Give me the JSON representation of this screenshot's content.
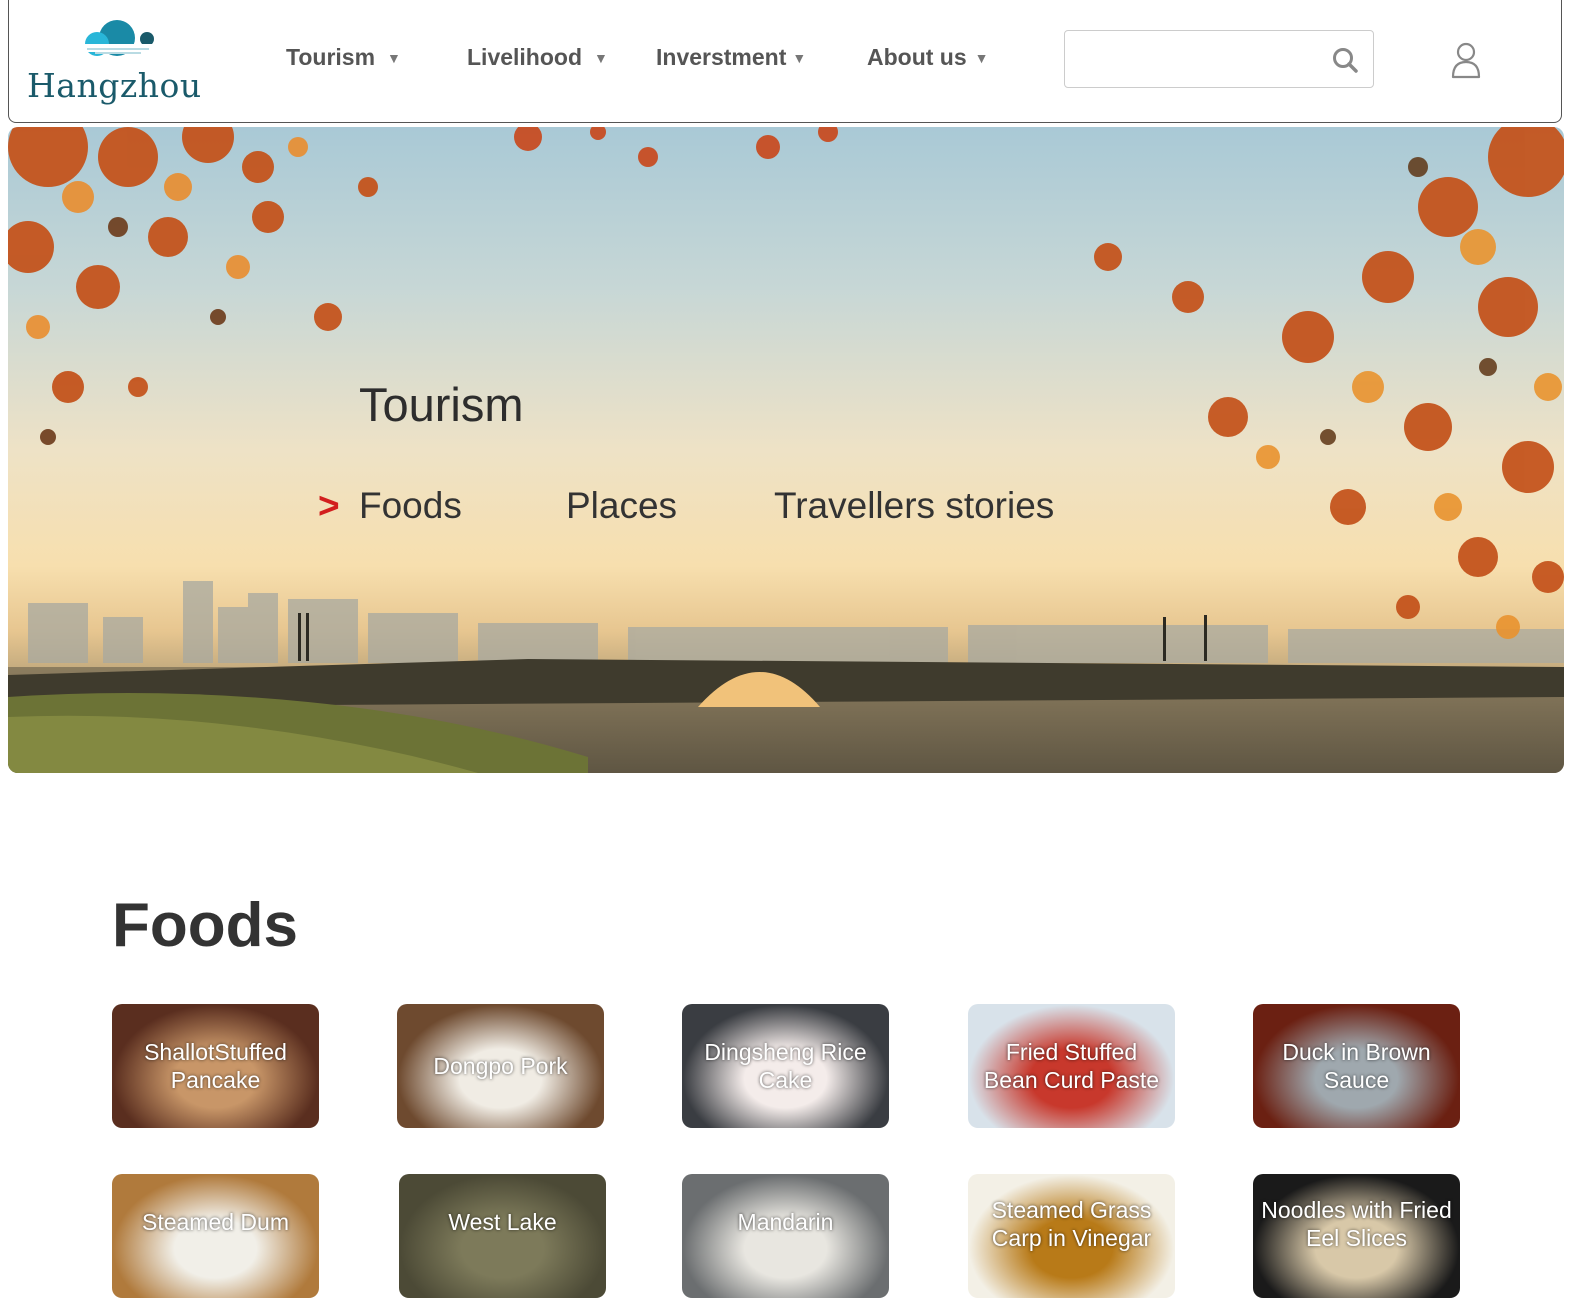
{
  "header": {
    "logo_text": "Hangzhou",
    "nav": [
      {
        "label": "Tourism"
      },
      {
        "label": "Livelihood"
      },
      {
        "label": "Inverstment"
      },
      {
        "label": "About us"
      }
    ],
    "search_value": "",
    "search_placeholder": ""
  },
  "hero": {
    "title": "Tourism",
    "arrow": ">",
    "tabs": [
      "Foods",
      "Places",
      "Travellers stories"
    ]
  },
  "foods": {
    "title": "Foods",
    "items": [
      {
        "label": "ShallotStuffed Pancake",
        "color_a": "#5a2e1f",
        "color_b": "#c89668"
      },
      {
        "label": "Dongpo Pork",
        "color_a": "#6e4a2f",
        "color_b": "#f0ece4"
      },
      {
        "label": "Dingsheng Rice Cake",
        "color_a": "#3a3d42",
        "color_b": "#f4ecea"
      },
      {
        "label": "Fried Stuffed Bean Curd Paste",
        "color_a": "#d8e2ea",
        "color_b": "#c8382c"
      },
      {
        "label": "Duck in Brown Sauce",
        "color_a": "#6b2012",
        "color_b": "#9fa8ae"
      },
      {
        "label": "Steamed Dum",
        "color_a": "#b07a3c",
        "color_b": "#f1efe8"
      },
      {
        "label": "West Lake",
        "color_a": "#4c4a36",
        "color_b": "#7d7a5a"
      },
      {
        "label": "Mandarin",
        "color_a": "#6b6e70",
        "color_b": "#e8e6e0"
      },
      {
        "label": "Steamed Grass Carp in Vinegar",
        "color_a": "#f3f0e6",
        "color_b": "#b87a18"
      },
      {
        "label": "Noodles with Fried Eel Slices",
        "color_a": "#1a1a1a",
        "color_b": "#d8c8a8"
      }
    ]
  },
  "colors": {
    "logo_teal": "#1a5a6a",
    "accent_red": "#d21f1f"
  }
}
